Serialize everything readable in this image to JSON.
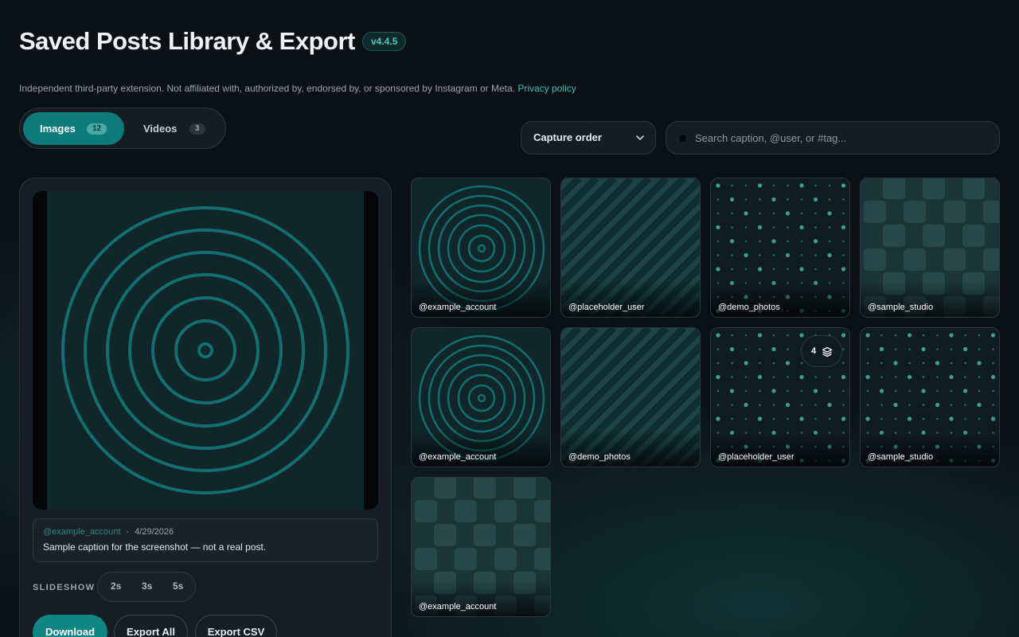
{
  "header": {
    "title": "Saved Posts Library & Export",
    "version": "v4.4.5",
    "disclaimer": "Independent third-party extension. Not affiliated with, authorized by, endorsed by, or sponsored by Instagram or Meta.",
    "privacy_link": "Privacy policy"
  },
  "tabs": [
    {
      "label": "Images",
      "count": "12",
      "active": true
    },
    {
      "label": "Videos",
      "count": "3",
      "active": false
    }
  ],
  "sort": {
    "selected": "Capture order",
    "icon": "chevron-down-icon"
  },
  "search": {
    "placeholder": "Search caption, @user, or #tag..."
  },
  "viewer": {
    "username": "@example_account",
    "separator": "·",
    "date": "4/29/2026",
    "caption": "Sample caption for the screenshot — not a real post.",
    "slideshow_label": "SLIDESHOW",
    "speeds": [
      "2s",
      "3s",
      "5s"
    ],
    "buttons": {
      "download": "Download",
      "export_all": "Export All",
      "export_csv": "Export CSV"
    }
  },
  "grid": [
    {
      "user": "@example_account",
      "pattern": "rings"
    },
    {
      "user": "@placeholder_user",
      "pattern": "stripes"
    },
    {
      "user": "@demo_photos",
      "pattern": "dots"
    },
    {
      "user": "@sample_studio",
      "pattern": "blocks"
    },
    {
      "user": "@example_account",
      "pattern": "rings"
    },
    {
      "user": "@demo_photos",
      "pattern": "stripes"
    },
    {
      "user": "@placeholder_user",
      "pattern": "dots",
      "multi_count": "4",
      "multi_icon": "layers-icon"
    },
    {
      "user": "@sample_studio",
      "pattern": "dots"
    },
    {
      "user": "@example_account",
      "pattern": "blocks"
    }
  ],
  "colors": {
    "accent": "#0f7a7a",
    "link": "#3fbfb5",
    "background": "#0b1015"
  }
}
